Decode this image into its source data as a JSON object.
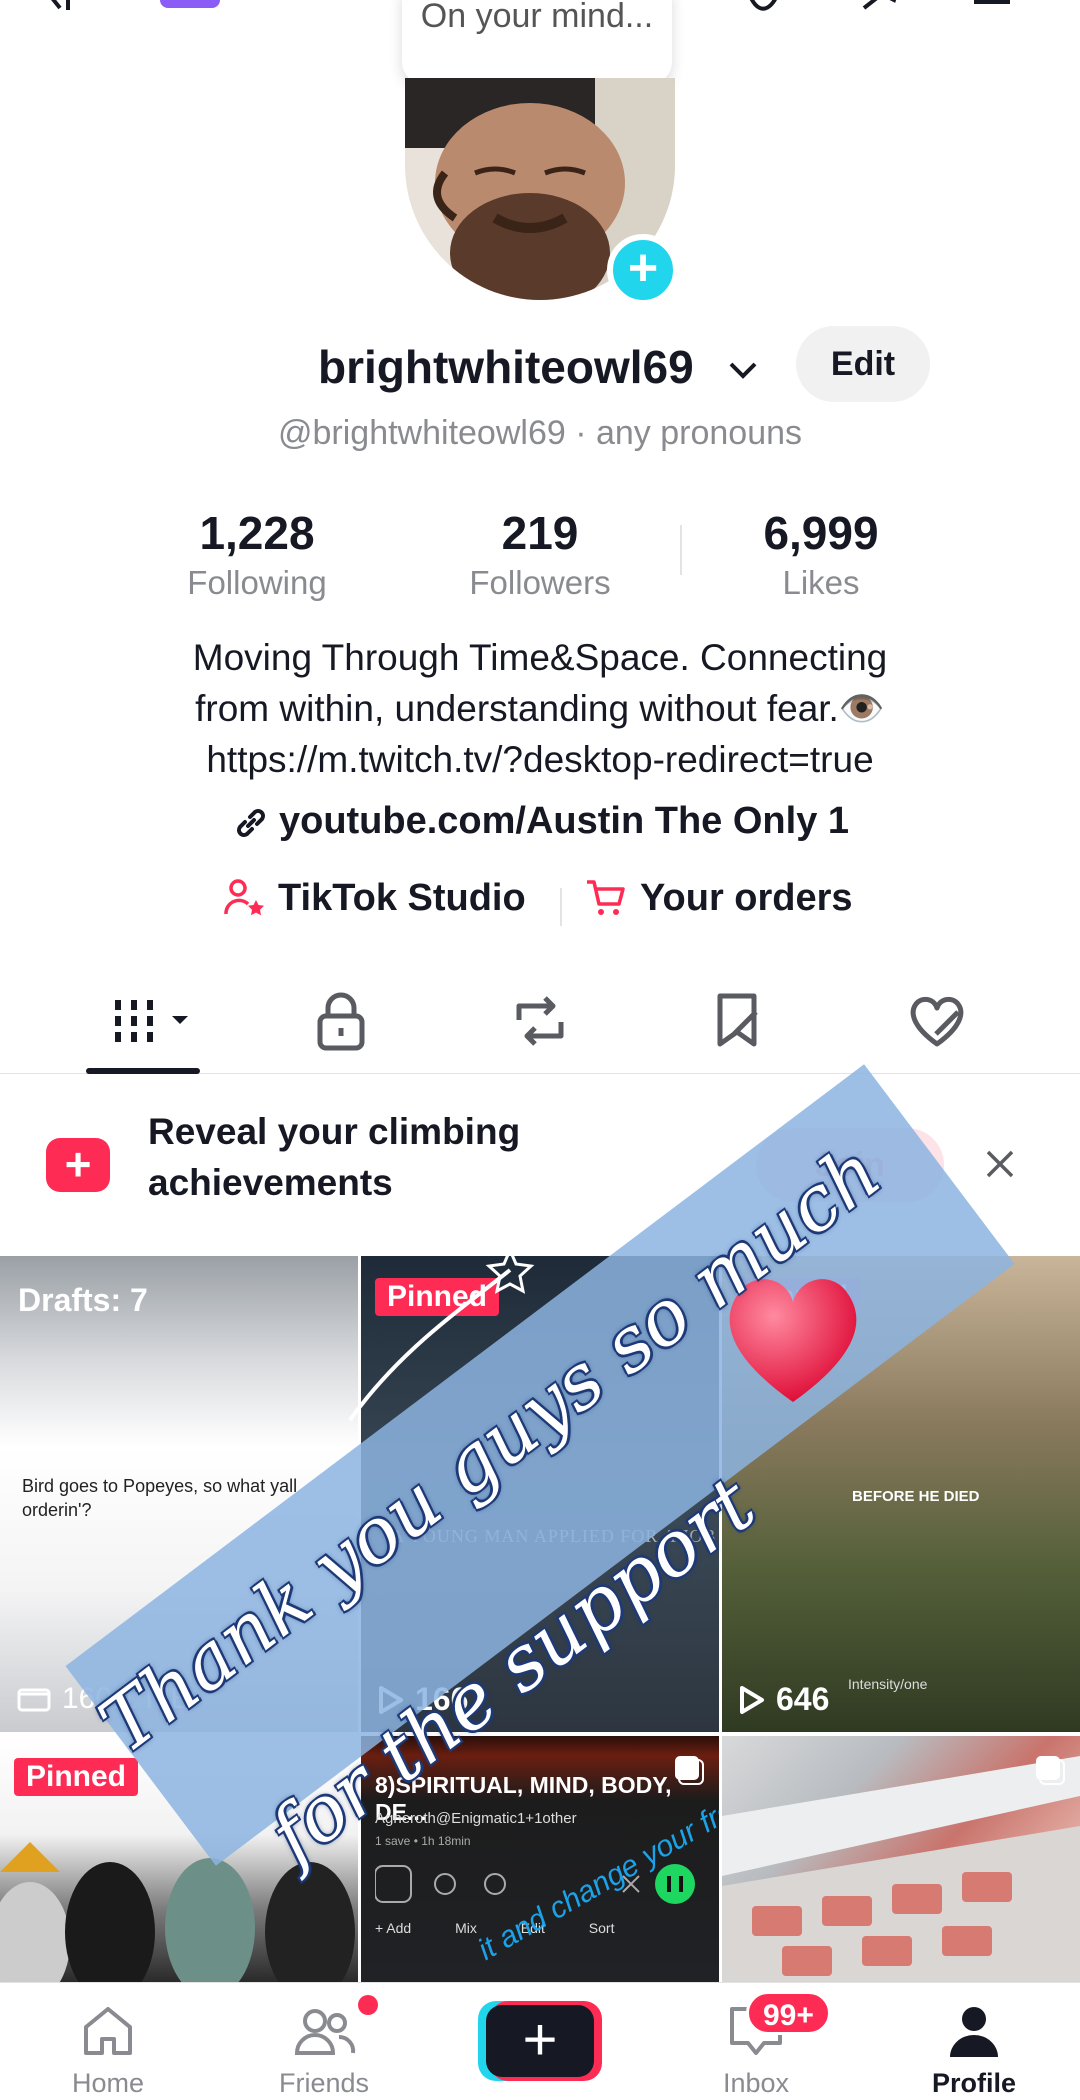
{
  "top": {
    "thought_bubble": "On your mind..."
  },
  "profile": {
    "username": "brightwhiteowl69",
    "edit_label": "Edit",
    "handle": "@brightwhiteowl69 · any pronouns"
  },
  "stats": [
    {
      "value": "1,228",
      "label": "Following"
    },
    {
      "value": "219",
      "label": "Followers"
    },
    {
      "value": "6,999",
      "label": "Likes"
    }
  ],
  "bio": {
    "line1": "Moving Through Time&Space. Connecting",
    "line2": "from within, understanding without fear.👁️",
    "line3": "https://m.twitch.tv/?desktop-redirect=true"
  },
  "link": "youtube.com/Austin The Only 1",
  "shortcuts": {
    "studio": "TikTok Studio",
    "orders": "Your orders"
  },
  "tabs": [
    "videos",
    "private",
    "reposts",
    "favorites",
    "liked"
  ],
  "banner": {
    "line1": "Reveal your climbing",
    "line2": "achievements",
    "button": "Join"
  },
  "grid": {
    "drafts_label": "Drafts: 7",
    "draft_text": "Bird goes to Popeyes, so what yall orderin'?",
    "draft_size": "160.1 MB",
    "pinned_label": "Pinned",
    "tile2_views": "166",
    "tile2_caption": "A YOUNG MAN APPLIED FOR A JOB",
    "tile3_views": "646",
    "tile3_caption": "BEFORE HE DIED",
    "tile3_sub": "Intensity/one",
    "tile5_title": "8)SPIRITUAL, MIND, BODY, DE...",
    "tile5_author": "Agneroth@Enigmatic1+1other",
    "tile5_meta": "1 save • 1h 18min",
    "tile5_buttons": [
      "+ Add",
      "Mix",
      "Edit",
      "Sort"
    ]
  },
  "sticker": {
    "line1": "Thank you guys so much",
    "line2": "for the support",
    "tile5_overlay": "it and change your frequency."
  },
  "nav": {
    "home": "Home",
    "friends": "Friends",
    "inbox": "Inbox",
    "inbox_badge": "99+",
    "profile": "Profile"
  },
  "colors": {
    "accent": "#fe2c55",
    "cyan": "#20d5ec",
    "text": "#161823",
    "muted": "#8a8b91"
  }
}
